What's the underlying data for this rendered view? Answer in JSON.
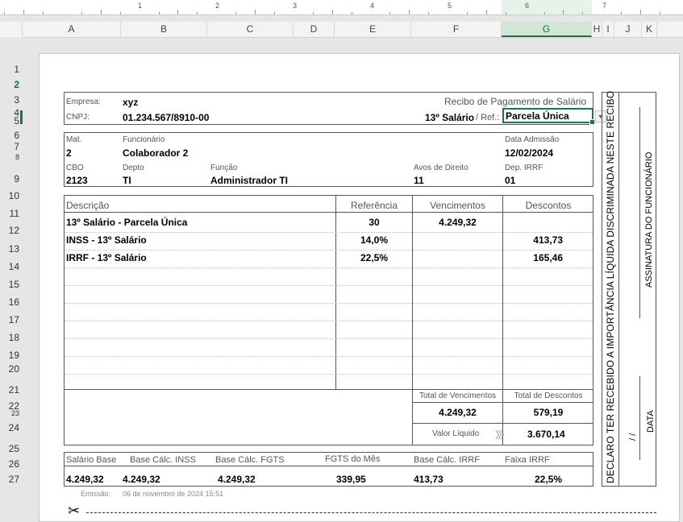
{
  "ruler": {
    "numbers": [
      "1",
      "2",
      "3",
      "4",
      "5",
      "6",
      "7"
    ]
  },
  "columns": [
    "A",
    "B",
    "C",
    "D",
    "E",
    "F",
    "G",
    "H",
    "I",
    "J",
    "K"
  ],
  "rows": [
    "1",
    "2",
    "3",
    "4",
    "5",
    "6",
    "7",
    "8",
    "9",
    "10",
    "11",
    "12",
    "13",
    "14",
    "15",
    "16",
    "17",
    "18",
    "19",
    "20",
    "21",
    "22",
    "23",
    "24",
    "25",
    "26",
    "27"
  ],
  "header": {
    "empresa_label": "Empresa:",
    "empresa": "xyz",
    "cnpj_label": "CNPJ:",
    "cnpj": "01.234.567/8910-00",
    "title": "Recibo de Pagamento de Salário",
    "tipo": "13º Salário",
    "ref_label": "/ Ref.:",
    "ref_value": "Parcela Única"
  },
  "employee": {
    "mat_label": "Mat.",
    "mat": "2",
    "func_label": "Funcionário",
    "func": "Colaborador 2",
    "adm_label": "Data Admissão",
    "adm": "12/02/2024",
    "cbo_label": "CBO",
    "cbo": "2123",
    "depto_label": "Depto",
    "depto": "TI",
    "funcao_label": "Função",
    "funcao": "Administrador TI",
    "avos_label": "Avos de Direito",
    "avos": "11",
    "dep_label": "Dep. IRRF",
    "dep": "01"
  },
  "table": {
    "col_descricao": "Descrição",
    "col_referencia": "Referência",
    "col_vencimentos": "Vencimentos",
    "col_descontos": "Descontos",
    "items": [
      {
        "desc": "13º Salário - Parcela Única",
        "ref": "30",
        "venc": "4.249,32",
        "descto": ""
      },
      {
        "desc": "INSS - 13º Salário",
        "ref": "14,0%",
        "venc": "",
        "descto": "413,73"
      },
      {
        "desc": "IRRF - 13º Salário",
        "ref": "22,5%",
        "venc": "",
        "descto": "165,46"
      }
    ]
  },
  "totals": {
    "venc_label": "Total de Vencimentos",
    "desc_label": "Total de Descontos",
    "venc": "4.249,32",
    "desc": "579,19",
    "liquido_label": "Valor Líquido",
    "liquido_arrow": "〉〉〉",
    "liquido": "3.670,14"
  },
  "footer": {
    "salario_base_label": "Salário Base",
    "salario_base": "4.249,32",
    "base_inss_label": "Base Cálc. INSS",
    "base_inss": "4.249,32",
    "base_fgts_label": "Base Cálc. FGTS",
    "base_fgts": "4.249,32",
    "fgts_mes_label": "FGTS do Mês",
    "fgts_mes": "339,95",
    "base_irrf_label": "Base Cálc. IRRF",
    "base_irrf": "413,73",
    "faixa_irrf_label": "Faixa IRRF",
    "faixa_irrf": "22,5%"
  },
  "emissao_label": "Emissão:",
  "emissao": "06 de novembro de 2024 15:51",
  "side": {
    "declaro": "DECLARO TER RECEBIDO A IMPORTÂNCIA LÍQUIDA DISCRIMINADA NESTE RECIBO",
    "assinatura": "ASSINATURA DO FUNCIONÁRIO",
    "data": "DATA",
    "date_slashes": "/          /"
  },
  "colors": {
    "accent": "#217346",
    "selection": "#d3e7d9"
  }
}
